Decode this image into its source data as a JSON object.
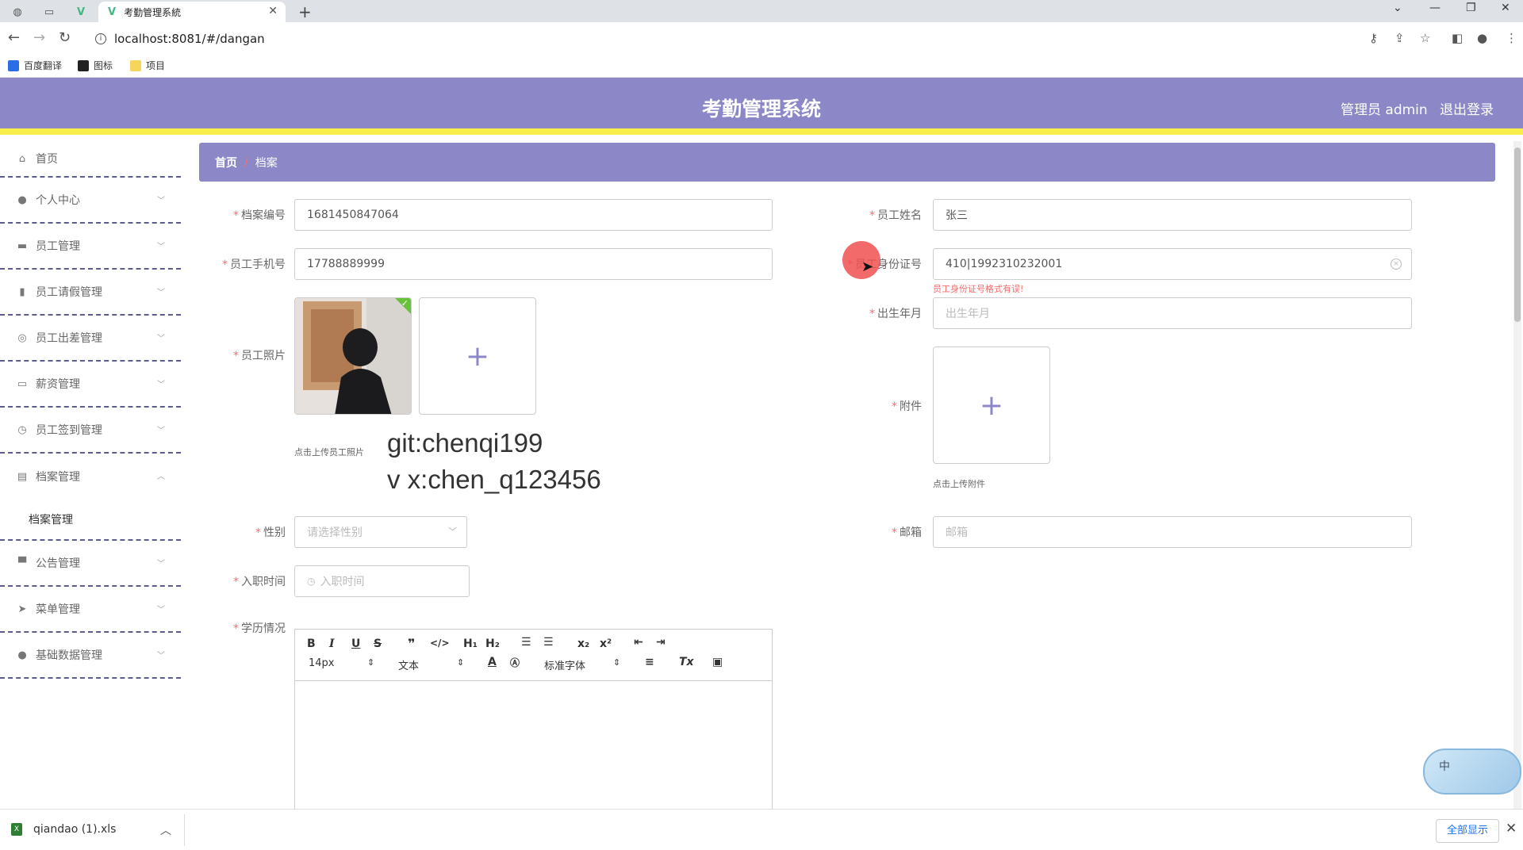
{
  "browser": {
    "tab_title": "考勤管理系統",
    "tab_close": "✕",
    "new_tab": "+",
    "url": "localhost:8081/#/dangan",
    "bookmarks": [
      "百度翻译",
      "图标",
      "项目"
    ]
  },
  "header": {
    "title": "考勤管理系统",
    "user": "管理员 admin",
    "logout": "退出登录"
  },
  "sidebar": {
    "items": [
      {
        "label": "首页",
        "icon": "home-icon"
      },
      {
        "label": "个人中心",
        "icon": "user-icon"
      },
      {
        "label": "员工管理",
        "icon": "briefcase-icon"
      },
      {
        "label": "员工请假管理",
        "icon": "chart-icon"
      },
      {
        "label": "员工出差管理",
        "icon": "globe-icon"
      },
      {
        "label": "薪资管理",
        "icon": "wallet-icon"
      },
      {
        "label": "员工签到管理",
        "icon": "clock-icon"
      },
      {
        "label": "档案管理",
        "icon": "clipboard-icon"
      },
      {
        "label": "公告管理",
        "icon": "monitor-icon"
      },
      {
        "label": "菜单管理",
        "icon": "send-icon"
      },
      {
        "label": "基础数据管理",
        "icon": "user-icon"
      }
    ],
    "submenu_active": "档案管理"
  },
  "breadcrumb": {
    "home": "首页",
    "separator": "/",
    "current": "档案"
  },
  "form": {
    "archive_no": {
      "label": "档案编号",
      "value": "1681450847064"
    },
    "employee_name": {
      "label": "员工姓名",
      "value": "张三"
    },
    "phone": {
      "label": "员工手机号",
      "value": "17788889999"
    },
    "id_card": {
      "label": "员工身份证号",
      "value": "410|1992310232001",
      "error": "员工身份证号格式有误!"
    },
    "birth": {
      "label": "出生年月",
      "placeholder": "出生年月"
    },
    "photo": {
      "label": "员工照片",
      "tip": "点击上传员工照片"
    },
    "attachment": {
      "label": "附件",
      "tip": "点击上传附件"
    },
    "gender": {
      "label": "性别",
      "placeholder": "请选择性别"
    },
    "email": {
      "label": "邮箱",
      "placeholder": "邮箱"
    },
    "hire_date": {
      "label": "入职时间",
      "placeholder": "入职时间"
    },
    "education": {
      "label": "学历情况"
    }
  },
  "watermark": {
    "line1": "git:chenqi199",
    "line2": "v x:chen_q123456"
  },
  "editor": {
    "font_size": "14px",
    "paragraph": "文本",
    "font_family": "标准字体"
  },
  "ime": {
    "label": "中"
  },
  "download": {
    "file": "qiandao (1).xls",
    "show_all": "全部显示"
  },
  "colors": {
    "header_bg": "#8c88c7",
    "header_border": "#f8ee4b",
    "required": "#f56c6c",
    "error": "#f56c6c"
  }
}
